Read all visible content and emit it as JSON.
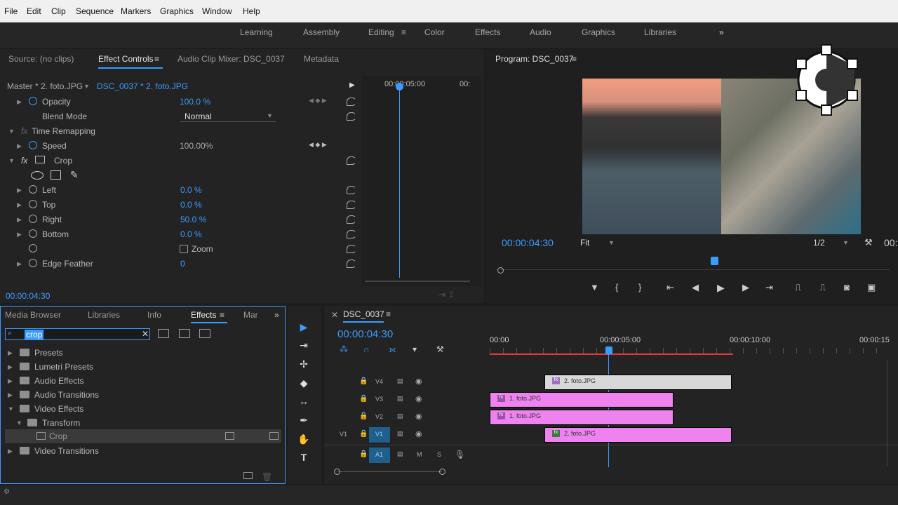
{
  "menu": [
    "File",
    "Edit",
    "Clip",
    "Sequence",
    "Markers",
    "Graphics",
    "Window",
    "Help"
  ],
  "workspaces": [
    "Learning",
    "Assembly",
    "Editing",
    "Color",
    "Effects",
    "Audio",
    "Graphics",
    "Libraries"
  ],
  "source_panel": {
    "tabs": [
      "Source: (no clips)",
      "Effect Controls",
      "Audio Clip Mixer: DSC_0037",
      "Metadata"
    ],
    "master": "Master * 2. foto.JPG",
    "clip": "DSC_0037 * 2. foto.JPG",
    "ruler_time": "00:00:05:00",
    "ruler_tail": "00:"
  },
  "effect_rows": {
    "opacity": {
      "label": "Opacity",
      "value": "100.0 %"
    },
    "blend": {
      "label": "Blend Mode",
      "value": "Normal"
    },
    "time_remap": {
      "label": "Time Remapping"
    },
    "speed": {
      "label": "Speed",
      "value": "100.00%"
    },
    "crop": {
      "label": "Crop"
    },
    "left": {
      "label": "Left",
      "value": "0.0 %"
    },
    "top": {
      "label": "Top",
      "value": "0.0 %"
    },
    "right": {
      "label": "Right",
      "value": "50.0 %"
    },
    "bottom": {
      "label": "Bottom",
      "value": "0.0 %"
    },
    "zoom": {
      "label": "Zoom"
    },
    "feather": {
      "label": "Edge Feather",
      "value": "0"
    }
  },
  "effect_time": "00:00:04:30",
  "program": {
    "title": "Program: DSC_0037",
    "timecode": "00:00:04:30",
    "fit": "Fit",
    "res": "1/2",
    "tail": "00:"
  },
  "effects_panel": {
    "tabs": [
      "Media Browser",
      "Libraries",
      "Info",
      "Effects",
      "Mar"
    ],
    "search": "crop",
    "tree": [
      "Presets",
      "Lumetri Presets",
      "Audio Effects",
      "Audio Transitions",
      "Video Effects",
      "Transform",
      "Crop",
      "Video Transitions"
    ]
  },
  "timeline": {
    "title": "DSC_0037",
    "timecode": "00:00:04:30",
    "ruler": [
      "00:00",
      "00:00:05:00",
      "00:00:10:00",
      "00:00:15"
    ],
    "tracks": [
      "V4",
      "V3",
      "V2",
      "V1",
      "A1"
    ],
    "ms": [
      "M",
      "S"
    ],
    "v1src": "V1",
    "clips": [
      "2. foto.JPG",
      "1. foto.JPG",
      "1. foto.JPG",
      "2. foto.JPG"
    ],
    "fx": "fx"
  },
  "colors": {
    "accent": "#3b9cff",
    "clip_pink": "#ee82ee",
    "clip_grey": "#d8d8d8",
    "render_bar": "#e03c3c"
  }
}
